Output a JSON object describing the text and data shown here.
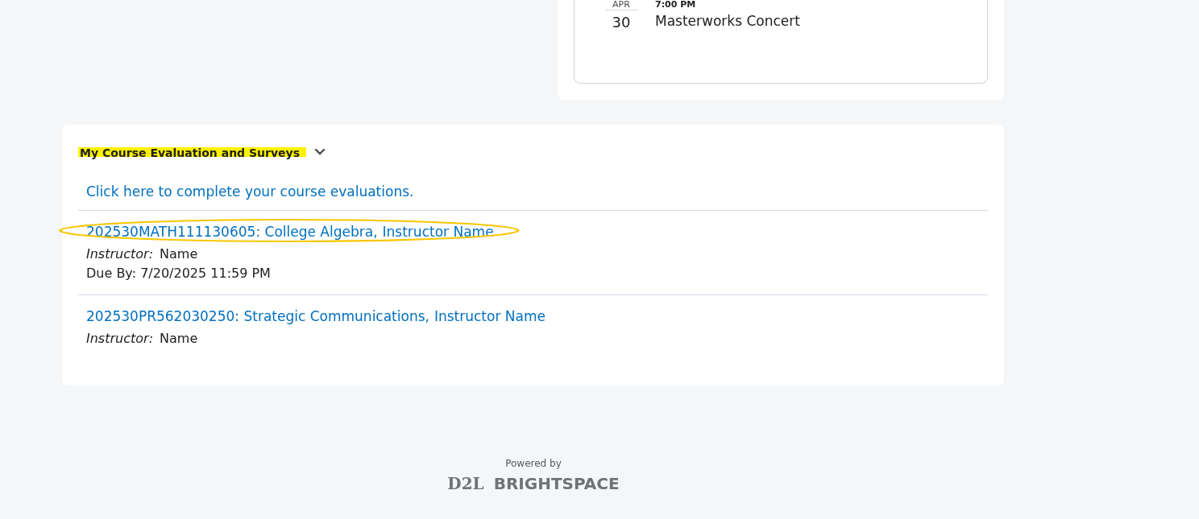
{
  "events_widget": {
    "event": {
      "month": "APR",
      "day": "30",
      "time": "7:00 PM",
      "title": "Masterworks Concert"
    }
  },
  "evaluations_widget": {
    "title": "My Course Evaluation and Surveys",
    "title_highlighted": true,
    "expanded": true,
    "intro_link": "Click here to complete your course evaluations.",
    "courses": [
      {
        "course": "202530MATH111130605: College Algebra,",
        "instructor_link": "Instructor Name",
        "instructor_label": "Instructor:",
        "instructor_name": "Name",
        "due": "Due By: 7/20/2025 11:59 PM",
        "circled": true
      },
      {
        "course": "202530PR562030250: Strategic Communications,",
        "instructor_link": "Instructor Name",
        "instructor_label": "Instructor:",
        "instructor_name": "Name",
        "circled": false
      }
    ]
  },
  "footer": {
    "powered_by": "Powered by",
    "logo_mark": "D2L",
    "logo_word": "BRIGHTSPACE"
  }
}
